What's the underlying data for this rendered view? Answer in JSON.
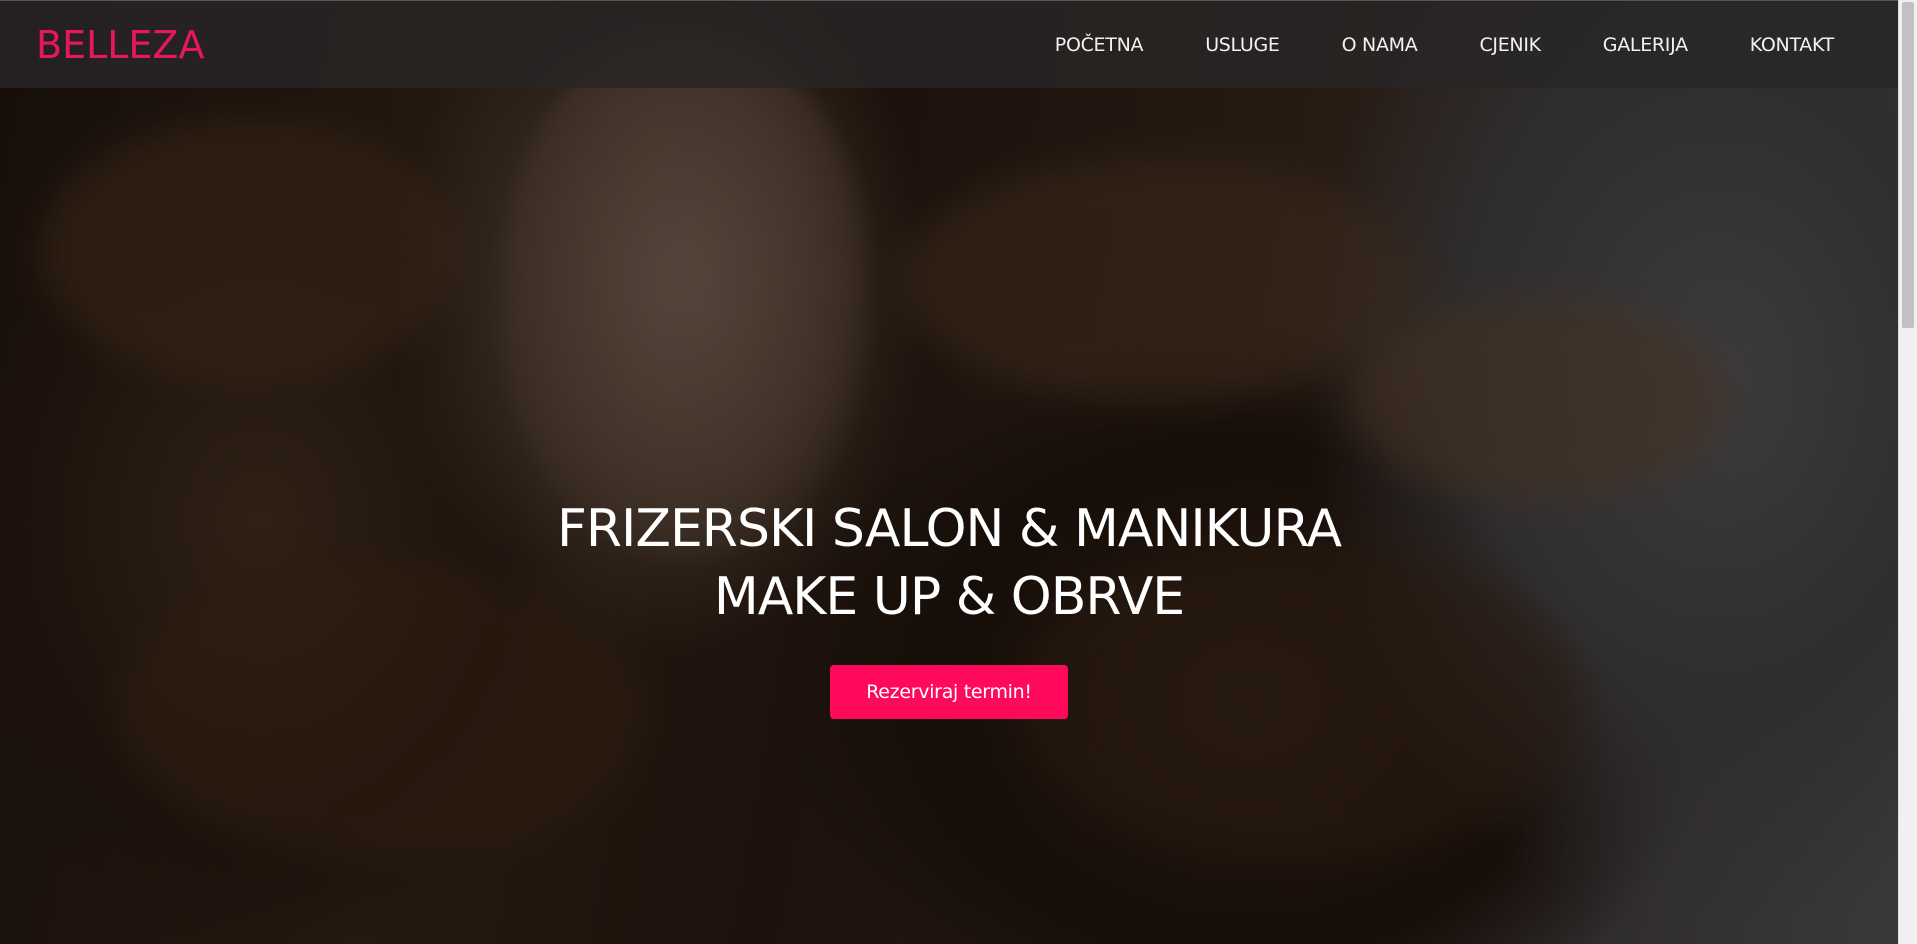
{
  "header": {
    "logo": "BELLEZA",
    "nav": [
      {
        "label": "POČETNA"
      },
      {
        "label": "USLUGE"
      },
      {
        "label": "O NAMA"
      },
      {
        "label": "CJENIK"
      },
      {
        "label": "GALERIJA"
      },
      {
        "label": "KONTAKT"
      }
    ]
  },
  "hero": {
    "title_line1": "FRIZERSKI SALON & MANIKURA",
    "title_line2": "MAKE UP & OBRVE",
    "cta_label": "Rezerviraj termin!"
  },
  "colors": {
    "brand": "#e6175c",
    "cta": "#ff0a5a",
    "navbar": "#2b2929"
  },
  "icons": {
    "background_image": "woman-with-long-wavy-brown-hair"
  }
}
